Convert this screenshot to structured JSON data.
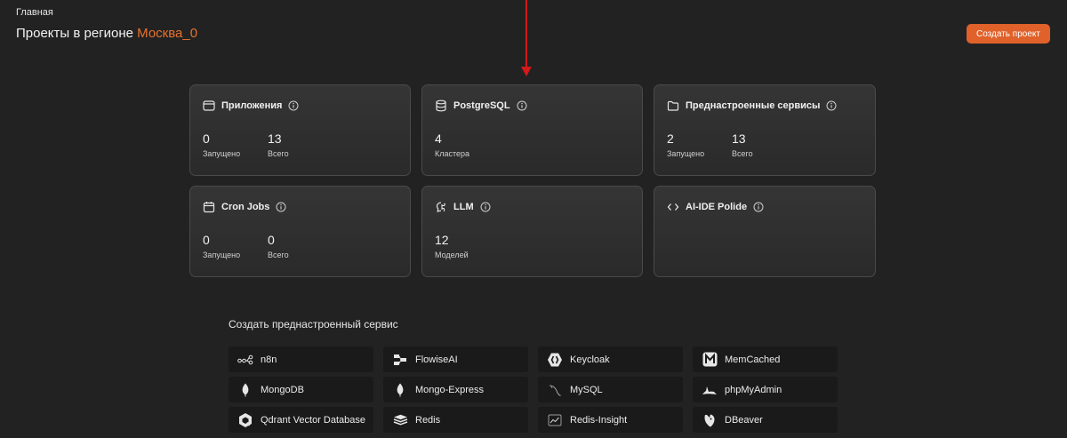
{
  "header": {
    "breadcrumb": "Главная",
    "title_prefix": "Проекты в регионе ",
    "region": "Москва_0",
    "create_button": "Создать проект"
  },
  "colors": {
    "accent": "#e0612a",
    "region_text": "#e8712f",
    "arrow": "#d11a1a",
    "background": "#222222"
  },
  "cards": [
    {
      "title": "Приложения",
      "icon": "window-icon",
      "stats": [
        {
          "value": "0",
          "label": "Запущено"
        },
        {
          "value": "13",
          "label": "Всего"
        }
      ]
    },
    {
      "title": "PostgreSQL",
      "icon": "database-icon",
      "stats": [
        {
          "value": "4",
          "label": "Кластера"
        }
      ]
    },
    {
      "title": "Преднастроенные сервисы",
      "icon": "folder-icon",
      "stats": [
        {
          "value": "2",
          "label": "Запущено"
        },
        {
          "value": "13",
          "label": "Всего"
        }
      ]
    },
    {
      "title": "Cron Jobs",
      "icon": "calendar-icon",
      "stats": [
        {
          "value": "0",
          "label": "Запущено"
        },
        {
          "value": "0",
          "label": "Всего"
        }
      ]
    },
    {
      "title": "LLM",
      "icon": "brain-icon",
      "stats": [
        {
          "value": "12",
          "label": "Моделей"
        }
      ]
    },
    {
      "title": "AI-IDE Polide",
      "icon": "code-icon",
      "stats": []
    }
  ],
  "services_section": {
    "title": "Создать преднастроенный сервис",
    "items": [
      {
        "label": "n8n",
        "icon": "n8n-icon"
      },
      {
        "label": "FlowiseAI",
        "icon": "flowise-icon"
      },
      {
        "label": "Keycloak",
        "icon": "keycloak-icon"
      },
      {
        "label": "MemCached",
        "icon": "memcached-icon"
      },
      {
        "label": "MongoDB",
        "icon": "mongodb-icon"
      },
      {
        "label": "Mongo-Express",
        "icon": "mongo-express-icon"
      },
      {
        "label": "MySQL",
        "icon": "mysql-icon"
      },
      {
        "label": "phpMyAdmin",
        "icon": "phpmyadmin-icon"
      },
      {
        "label": "Qdrant Vector Database",
        "icon": "qdrant-icon"
      },
      {
        "label": "Redis",
        "icon": "redis-icon"
      },
      {
        "label": "Redis-Insight",
        "icon": "redis-insight-icon"
      },
      {
        "label": "DBeaver",
        "icon": "dbeaver-icon"
      }
    ]
  }
}
